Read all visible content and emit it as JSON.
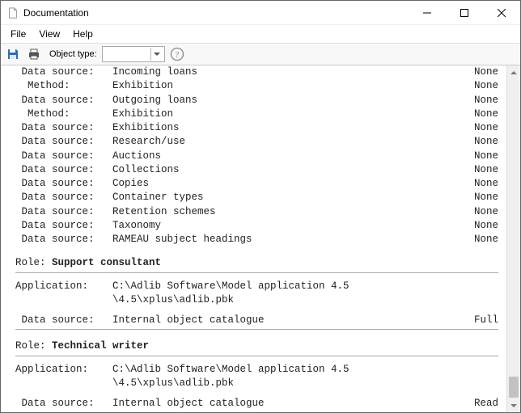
{
  "window": {
    "title": "Documentation"
  },
  "menu": {
    "file": "File",
    "view": "View",
    "help": "Help"
  },
  "toolbar": {
    "object_type_label": "Object type:"
  },
  "access": {
    "none": "None",
    "full": "Full",
    "read": "Read"
  },
  "labels": {
    "data_source": " Data source:",
    "method": "  Method:",
    "role": "Role: ",
    "application": "Application:"
  },
  "top": {
    "rows": [
      {
        "k": " Data source:",
        "v": "Incoming loans",
        "a": "None"
      },
      {
        "k": "  Method:",
        "v": "Exhibition",
        "a": "None"
      },
      {
        "k": " Data source:",
        "v": "Outgoing loans",
        "a": "None"
      },
      {
        "k": "  Method:",
        "v": "Exhibition",
        "a": "None"
      },
      {
        "k": " Data source:",
        "v": "Exhibitions",
        "a": "None"
      },
      {
        "k": " Data source:",
        "v": "Research/use",
        "a": "None"
      },
      {
        "k": " Data source:",
        "v": "Auctions",
        "a": "None"
      },
      {
        "k": " Data source:",
        "v": "Collections",
        "a": "None"
      },
      {
        "k": " Data source:",
        "v": "Copies",
        "a": "None"
      },
      {
        "k": " Data source:",
        "v": "Container types",
        "a": "None"
      },
      {
        "k": " Data source:",
        "v": "Retention schemes",
        "a": "None"
      },
      {
        "k": " Data source:",
        "v": "Taxonomy",
        "a": "None"
      },
      {
        "k": " Data source:",
        "v": "RAMEAU subject headings",
        "a": "None"
      }
    ]
  },
  "sections": [
    {
      "role": "Support consultant",
      "application": "C:\\Adlib Software\\Model application 4.5\\4.5\\xplus\\adlib.pbk",
      "ds": {
        "name": "Internal object catalogue",
        "access": "Full"
      }
    },
    {
      "role": "Technical writer",
      "application": "C:\\Adlib Software\\Model application 4.5\\4.5\\xplus\\adlib.pbk",
      "ds": {
        "name": "Internal object catalogue",
        "access": "Read"
      }
    }
  ]
}
